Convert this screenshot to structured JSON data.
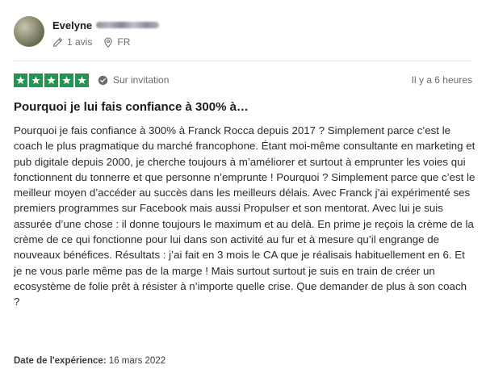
{
  "reviewer": {
    "first_name": "Evelyne",
    "reviews_count": "1 avis",
    "country": "FR"
  },
  "review": {
    "rating": 5,
    "rating_max": 5,
    "verification": "Sur invitation",
    "date_ago": "Il y a 6 heures",
    "title": "Pourquoi je lui fais confiance à 300% à…",
    "body": "Pourquoi je fais confiance à 300% à Franck Rocca depuis 2017 ? Simplement parce c’est le coach le plus pragmatique du marché francophone. Étant moi-même consultante en marketing et pub digitale depuis 2000, je cherche toujours à m’améliorer et surtout à emprunter les voies qui fonctionnent du tonnerre et que personne n’emprunte ! Pourquoi ? Simplement parce que c’est le meilleur moyen d’accéder au succès dans les meilleurs délais. Avec Franck j’ai expérimenté ses premiers programmes sur Facebook mais aussi Propulser et son mentorat. Avec lui je suis assurée d’une chose : il donne toujours le maximum et au delà. En prime je reçois la crème de la crème de ce qui fonctionne pour lui dans son activité au fur et à mesure qu’il engrange de nouveaux bénéfices. Résultats : j’ai fait en 3 mois le CA que je réalisais habituellement en 6. Et je ne vous parle même pas de la marge ! Mais surtout surtout je suis en train de créer un ecosystème de folie prêt à résister à n’importe quelle crise. Que demander de plus à son coach ?",
    "experience_label": "Date de l'expérience:",
    "experience_date": "16 mars 2022"
  },
  "colors": {
    "star_bg": "#219653",
    "muted_text": "#6b6b6b"
  },
  "icons": {
    "reviews": "pencil-icon",
    "location": "location-pin-icon",
    "verification": "invitation-badge-icon",
    "star": "star-icon"
  }
}
